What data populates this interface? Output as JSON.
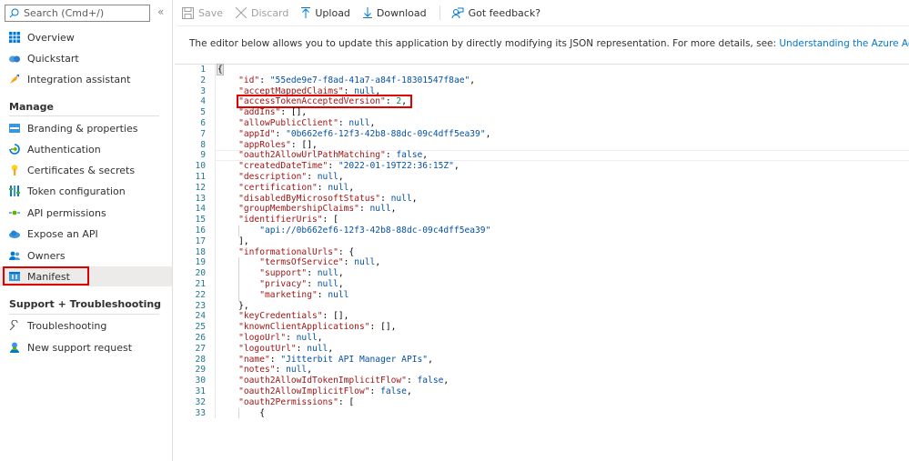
{
  "sidebar": {
    "search_placeholder": "Search (Cmd+/)",
    "collapse_icon": "«",
    "top_items": [
      {
        "label": "Overview",
        "icon": "overview-icon"
      },
      {
        "label": "Quickstart",
        "icon": "quickstart-icon"
      },
      {
        "label": "Integration assistant",
        "icon": "rocket-icon"
      }
    ],
    "manage_heading": "Manage",
    "manage_items": [
      {
        "label": "Branding & properties",
        "icon": "branding-icon"
      },
      {
        "label": "Authentication",
        "icon": "authentication-icon"
      },
      {
        "label": "Certificates & secrets",
        "icon": "key-icon"
      },
      {
        "label": "Token configuration",
        "icon": "token-icon"
      },
      {
        "label": "API permissions",
        "icon": "api-permissions-icon"
      },
      {
        "label": "Expose an API",
        "icon": "cloud-icon"
      },
      {
        "label": "Owners",
        "icon": "owners-icon"
      },
      {
        "label": "Manifest",
        "icon": "manifest-icon",
        "active": true
      }
    ],
    "support_heading": "Support + Troubleshooting",
    "support_items": [
      {
        "label": "Troubleshooting",
        "icon": "wrench-icon"
      },
      {
        "label": "New support request",
        "icon": "support-person-icon"
      }
    ]
  },
  "toolbar": {
    "save": "Save",
    "discard": "Discard",
    "upload": "Upload",
    "download": "Download",
    "feedback": "Got feedback?"
  },
  "description": {
    "text": "The editor below allows you to update this application by directly modifying its JSON representation. For more details, see: ",
    "link": "Understanding the Azure Active Directory application manifest."
  },
  "editor": {
    "current_line": 9,
    "highlighted_line": 4,
    "lines": [
      {
        "n": "1",
        "indent": 0,
        "tokens": [
          [
            "p",
            "{"
          ]
        ]
      },
      {
        "n": "2",
        "indent": 1,
        "tokens": [
          [
            "k",
            "\"id\""
          ],
          [
            "p",
            ": "
          ],
          [
            "s",
            "\"55ede9e7-f8ad-41a7-a84f-18301547f8ae\""
          ],
          [
            "p",
            ","
          ]
        ]
      },
      {
        "n": "3",
        "indent": 1,
        "tokens": [
          [
            "k",
            "\"acceptMappedClaims\""
          ],
          [
            "p",
            ": "
          ],
          [
            "kw",
            "null"
          ],
          [
            "p",
            ","
          ]
        ]
      },
      {
        "n": "4",
        "indent": 1,
        "tokens": [
          [
            "k",
            "\"accessTokenAcceptedVersion\""
          ],
          [
            "p",
            ": "
          ],
          [
            "n",
            "2"
          ],
          [
            "p",
            ","
          ]
        ]
      },
      {
        "n": "5",
        "indent": 1,
        "tokens": [
          [
            "k",
            "\"addIns\""
          ],
          [
            "p",
            ": [],"
          ]
        ]
      },
      {
        "n": "6",
        "indent": 1,
        "tokens": [
          [
            "k",
            "\"allowPublicClient\""
          ],
          [
            "p",
            ": "
          ],
          [
            "kw",
            "null"
          ],
          [
            "p",
            ","
          ]
        ]
      },
      {
        "n": "7",
        "indent": 1,
        "tokens": [
          [
            "k",
            "\"appId\""
          ],
          [
            "p",
            ": "
          ],
          [
            "s",
            "\"0b662ef6-12f3-42b8-88dc-09c4dff5ea39\""
          ],
          [
            "p",
            ","
          ]
        ]
      },
      {
        "n": "8",
        "indent": 1,
        "tokens": [
          [
            "k",
            "\"appRoles\""
          ],
          [
            "p",
            ": [],"
          ]
        ]
      },
      {
        "n": "9",
        "indent": 1,
        "tokens": [
          [
            "k",
            "\"oauth2AllowUrlPathMatching\""
          ],
          [
            "p",
            ": "
          ],
          [
            "kw",
            "false"
          ],
          [
            "p",
            ","
          ]
        ]
      },
      {
        "n": "10",
        "indent": 1,
        "tokens": [
          [
            "k",
            "\"createdDateTime\""
          ],
          [
            "p",
            ": "
          ],
          [
            "s",
            "\"2022-01-19T22:36:15Z\""
          ],
          [
            "p",
            ","
          ]
        ]
      },
      {
        "n": "11",
        "indent": 1,
        "tokens": [
          [
            "k",
            "\"description\""
          ],
          [
            "p",
            ": "
          ],
          [
            "kw",
            "null"
          ],
          [
            "p",
            ","
          ]
        ]
      },
      {
        "n": "12",
        "indent": 1,
        "tokens": [
          [
            "k",
            "\"certification\""
          ],
          [
            "p",
            ": "
          ],
          [
            "kw",
            "null"
          ],
          [
            "p",
            ","
          ]
        ]
      },
      {
        "n": "13",
        "indent": 1,
        "tokens": [
          [
            "k",
            "\"disabledByMicrosoftStatus\""
          ],
          [
            "p",
            ": "
          ],
          [
            "kw",
            "null"
          ],
          [
            "p",
            ","
          ]
        ]
      },
      {
        "n": "14",
        "indent": 1,
        "tokens": [
          [
            "k",
            "\"groupMembershipClaims\""
          ],
          [
            "p",
            ": "
          ],
          [
            "kw",
            "null"
          ],
          [
            "p",
            ","
          ]
        ]
      },
      {
        "n": "15",
        "indent": 1,
        "tokens": [
          [
            "k",
            "\"identifierUris\""
          ],
          [
            "p",
            ": ["
          ]
        ]
      },
      {
        "n": "16",
        "indent": 2,
        "tokens": [
          [
            "s",
            "\"api://0b662ef6-12f3-42b8-88dc-09c4dff5ea39\""
          ]
        ]
      },
      {
        "n": "17",
        "indent": 1,
        "tokens": [
          [
            "p",
            "],"
          ]
        ]
      },
      {
        "n": "18",
        "indent": 1,
        "tokens": [
          [
            "k",
            "\"informationalUrls\""
          ],
          [
            "p",
            ": {"
          ]
        ]
      },
      {
        "n": "19",
        "indent": 2,
        "tokens": [
          [
            "k",
            "\"termsOfService\""
          ],
          [
            "p",
            ": "
          ],
          [
            "kw",
            "null"
          ],
          [
            "p",
            ","
          ]
        ]
      },
      {
        "n": "20",
        "indent": 2,
        "tokens": [
          [
            "k",
            "\"support\""
          ],
          [
            "p",
            ": "
          ],
          [
            "kw",
            "null"
          ],
          [
            "p",
            ","
          ]
        ]
      },
      {
        "n": "21",
        "indent": 2,
        "tokens": [
          [
            "k",
            "\"privacy\""
          ],
          [
            "p",
            ": "
          ],
          [
            "kw",
            "null"
          ],
          [
            "p",
            ","
          ]
        ]
      },
      {
        "n": "22",
        "indent": 2,
        "tokens": [
          [
            "k",
            "\"marketing\""
          ],
          [
            "p",
            ": "
          ],
          [
            "kw",
            "null"
          ]
        ]
      },
      {
        "n": "23",
        "indent": 1,
        "tokens": [
          [
            "p",
            "},"
          ]
        ]
      },
      {
        "n": "24",
        "indent": 1,
        "tokens": [
          [
            "k",
            "\"keyCredentials\""
          ],
          [
            "p",
            ": [],"
          ]
        ]
      },
      {
        "n": "25",
        "indent": 1,
        "tokens": [
          [
            "k",
            "\"knownClientApplications\""
          ],
          [
            "p",
            ": [],"
          ]
        ]
      },
      {
        "n": "26",
        "indent": 1,
        "tokens": [
          [
            "k",
            "\"logoUrl\""
          ],
          [
            "p",
            ": "
          ],
          [
            "kw",
            "null"
          ],
          [
            "p",
            ","
          ]
        ]
      },
      {
        "n": "27",
        "indent": 1,
        "tokens": [
          [
            "k",
            "\"logoutUrl\""
          ],
          [
            "p",
            ": "
          ],
          [
            "kw",
            "null"
          ],
          [
            "p",
            ","
          ]
        ]
      },
      {
        "n": "28",
        "indent": 1,
        "tokens": [
          [
            "k",
            "\"name\""
          ],
          [
            "p",
            ": "
          ],
          [
            "s",
            "\"Jitterbit API Manager APIs\""
          ],
          [
            "p",
            ","
          ]
        ]
      },
      {
        "n": "29",
        "indent": 1,
        "tokens": [
          [
            "k",
            "\"notes\""
          ],
          [
            "p",
            ": "
          ],
          [
            "kw",
            "null"
          ],
          [
            "p",
            ","
          ]
        ]
      },
      {
        "n": "30",
        "indent": 1,
        "tokens": [
          [
            "k",
            "\"oauth2AllowIdTokenImplicitFlow\""
          ],
          [
            "p",
            ": "
          ],
          [
            "kw",
            "false"
          ],
          [
            "p",
            ","
          ]
        ]
      },
      {
        "n": "31",
        "indent": 1,
        "tokens": [
          [
            "k",
            "\"oauth2AllowImplicitFlow\""
          ],
          [
            "p",
            ": "
          ],
          [
            "kw",
            "false"
          ],
          [
            "p",
            ","
          ]
        ]
      },
      {
        "n": "32",
        "indent": 1,
        "tokens": [
          [
            "k",
            "\"oauth2Permissions\""
          ],
          [
            "p",
            ": ["
          ]
        ]
      },
      {
        "n": "33",
        "indent": 2,
        "tokens": [
          [
            "p",
            "{"
          ]
        ]
      }
    ]
  }
}
